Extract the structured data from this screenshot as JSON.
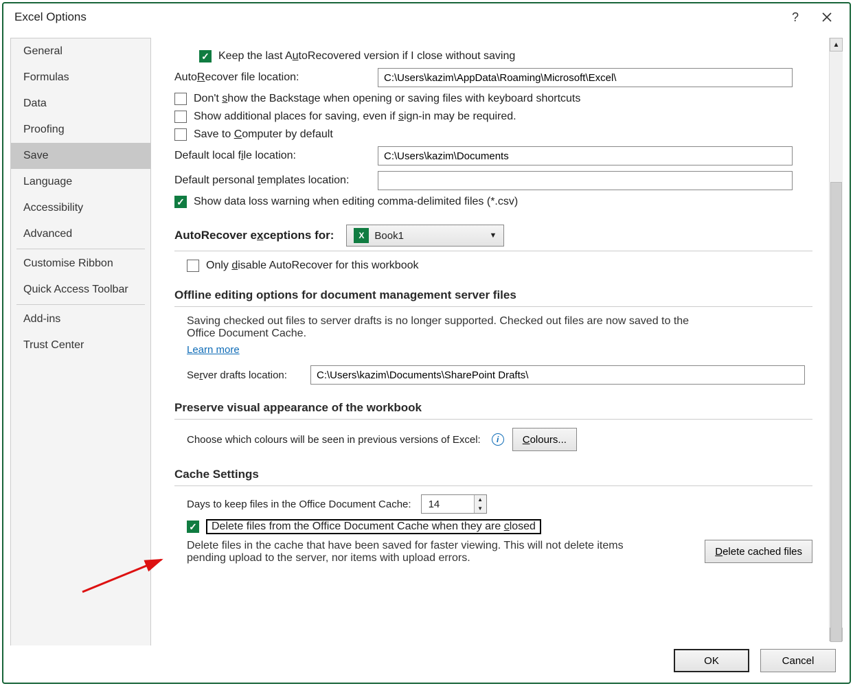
{
  "title": "Excel Options",
  "sidebar": {
    "items": [
      {
        "label": "General"
      },
      {
        "label": "Formulas"
      },
      {
        "label": "Data"
      },
      {
        "label": "Proofing"
      },
      {
        "label": "Save"
      },
      {
        "label": "Language"
      },
      {
        "label": "Accessibility"
      },
      {
        "label": "Advanced"
      },
      {
        "label": "Customise Ribbon"
      },
      {
        "label": "Quick Access Toolbar"
      },
      {
        "label": "Add-ins"
      },
      {
        "label": "Trust Center"
      }
    ]
  },
  "save": {
    "keep_autorecover_label": "Keep the last AutoRecovered version if I close without saving",
    "autorecover_loc_label": "AutoRecover file location:",
    "autorecover_loc_value": "C:\\Users\\kazim\\AppData\\Roaming\\Microsoft\\Excel\\",
    "dont_show_backstage": "Don't show the Backstage when opening or saving files with keyboard shortcuts",
    "show_additional_places": "Show additional places for saving, even if sign-in may be required.",
    "save_computer_default": "Save to Computer by default",
    "default_local_loc_label": "Default local file location:",
    "default_local_loc_value": "C:\\Users\\kazim\\Documents",
    "default_templates_label": "Default personal templates location:",
    "default_templates_value": "",
    "show_csv_warning": "Show data loss warning when editing comma-delimited files (*.csv)"
  },
  "autorecover_ex": {
    "label": "AutoRecover exceptions for:",
    "book": "Book1",
    "only_disable": "Only disable AutoRecover for this workbook"
  },
  "offline": {
    "heading": "Offline editing options for document management server files",
    "desc": "Saving checked out files to server drafts is no longer supported. Checked out files are now saved to the Office Document Cache.",
    "learn_more": "Learn more",
    "server_drafts_label": "Server drafts location:",
    "server_drafts_value": "C:\\Users\\kazim\\Documents\\SharePoint Drafts\\"
  },
  "preserve": {
    "heading": "Preserve visual appearance of the workbook",
    "desc": "Choose which colours will be seen in previous versions of Excel:",
    "colours_btn": "Colours..."
  },
  "cache": {
    "heading": "Cache Settings",
    "days_label": "Days to keep files in the Office Document Cache:",
    "days_value": "14",
    "delete_on_close": "Delete files from the Office Document Cache when they are closed",
    "delete_desc": "Delete files in the cache that have been saved for faster viewing. This will not delete items pending upload to the server, nor items with upload errors.",
    "delete_btn": "Delete cached files"
  },
  "footer": {
    "ok": "OK",
    "cancel": "Cancel"
  }
}
